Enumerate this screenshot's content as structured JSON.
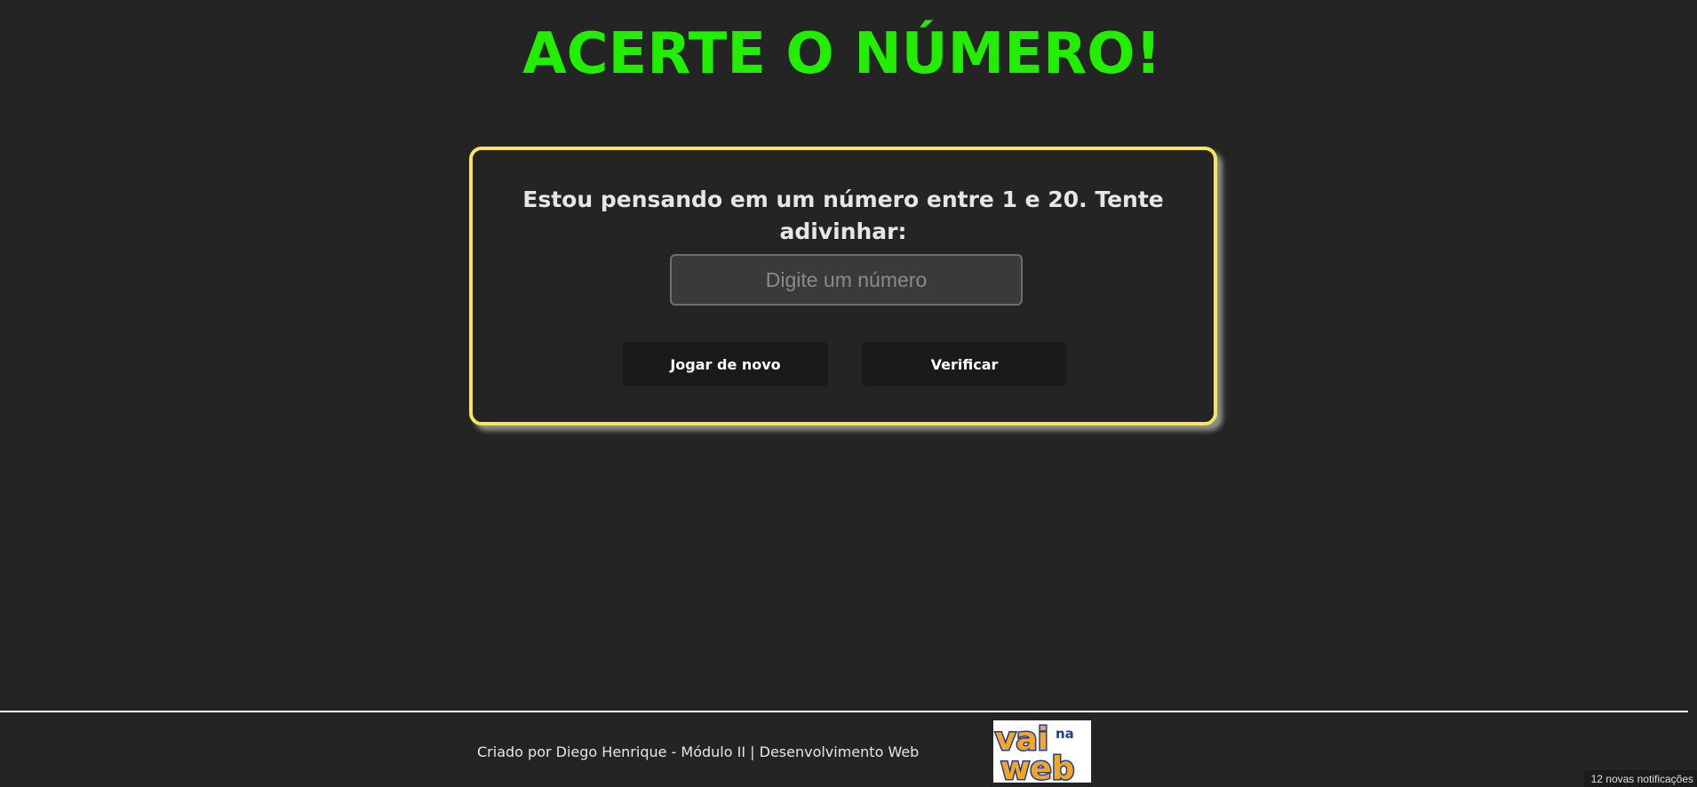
{
  "header": {
    "title": "ACERTE O NÚMERO!"
  },
  "game": {
    "prompt": "Estou pensando em um número entre 1 e 20. Tente adivinhar:",
    "input_placeholder": "Digite um número",
    "input_value": "",
    "reset_label": "Jogar de novo",
    "check_label": "Verificar"
  },
  "footer": {
    "credit": "Criado por Diego Henrique - Módulo II | Desenvolvimento Web",
    "logo_text": "vai na web"
  },
  "notification": {
    "text": "12 novas notificações"
  },
  "colors": {
    "background": "#242424",
    "title": "#22ee00",
    "card_border": "#f5e65a",
    "button_bg": "#1a1a1a",
    "logo_primary": "#f5a623",
    "logo_outline": "#1e3c9e"
  }
}
